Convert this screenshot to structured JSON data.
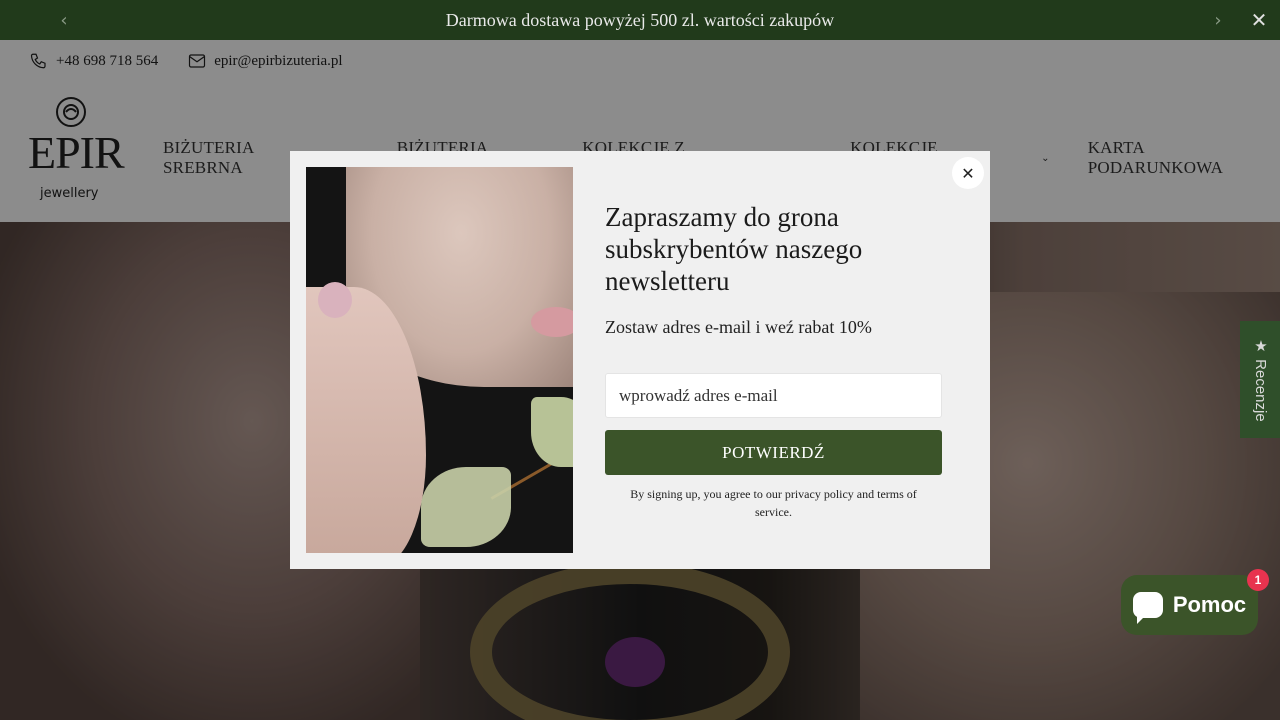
{
  "announcement": {
    "text": "Darmowa dostawa powyżej 500 zl. wartości zakupów",
    "prev_icon": "chevron-left-icon",
    "next_icon": "chevron-right-icon",
    "close_icon": "close-icon"
  },
  "contact": {
    "phone": "+48 698 718 564",
    "email": "epir@epirbizuteria.pl"
  },
  "logo": {
    "main": "EPIR",
    "sub": "jewellery"
  },
  "nav": {
    "items": [
      {
        "label": "BIŻUTERIA SREBRNA",
        "has_dropdown": true
      },
      {
        "label": "BIŻUTERIA ZŁOTA",
        "has_dropdown": false
      },
      {
        "label": "KOLEKCJE Z KAMIENIAMI",
        "has_dropdown": true
      },
      {
        "label": "KOLEKCJE AUTORSKIE",
        "has_dropdown": true
      },
      {
        "label": "KARTA PODARUNKOWA",
        "has_dropdown": false
      }
    ]
  },
  "reviews_tab": {
    "label": "★ Recenzje"
  },
  "modal": {
    "heading": "Zapraszamy do grona subskrybentów naszego newsletteru",
    "subheading": "Zostaw adres e-mail i weź rabat 10%",
    "email_placeholder": "wprowadź adres e-mail",
    "button_label": "POTWIERDŹ",
    "legal": "By signing up, you agree to our privacy policy and terms of service.",
    "close_icon": "close-icon"
  },
  "chat": {
    "label": "Pomoc",
    "badge": "1"
  },
  "colors": {
    "announcement_bg": "#213a1b",
    "brand_green": "#3b5429",
    "badge_red": "#e8334f"
  }
}
